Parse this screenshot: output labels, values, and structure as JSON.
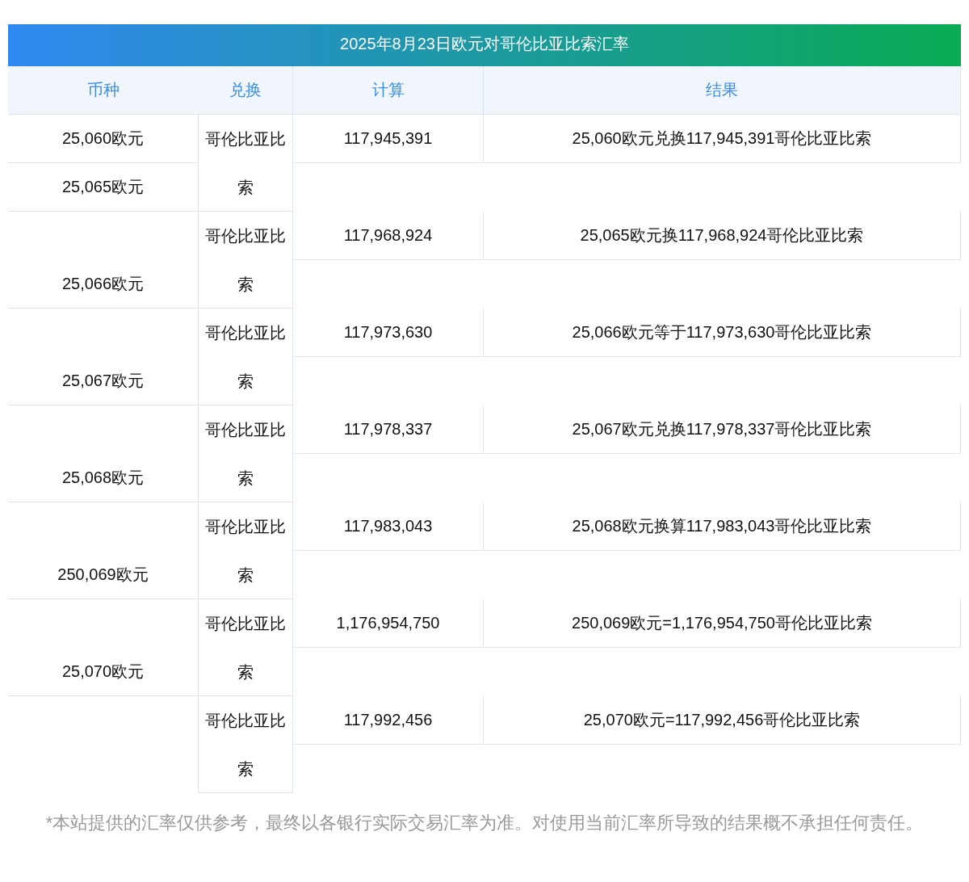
{
  "title": "2025年8月23日欧元对哥伦比亚比索汇率",
  "columns": [
    "币种",
    "兑换",
    "计算",
    "结果"
  ],
  "rows": [
    {
      "amount": "25,060欧元",
      "currency": "哥伦比亚比索",
      "calc": "117,945,391",
      "result": "25,060欧元兑换117,945,391哥伦比亚比索"
    },
    {
      "amount": "25,065欧元",
      "currency": "哥伦比亚比索",
      "calc": "117,968,924",
      "result": "25,065欧元换117,968,924哥伦比亚比索"
    },
    {
      "amount": "25,066欧元",
      "currency": "哥伦比亚比索",
      "calc": "117,973,630",
      "result": "25,066欧元等于117,973,630哥伦比亚比索"
    },
    {
      "amount": "25,067欧元",
      "currency": "哥伦比亚比索",
      "calc": "117,978,337",
      "result": "25,067欧元兑换117,978,337哥伦比亚比索"
    },
    {
      "amount": "25,068欧元",
      "currency": "哥伦比亚比索",
      "calc": "117,983,043",
      "result": "25,068欧元换算117,983,043哥伦比亚比索"
    },
    {
      "amount": "250,069欧元",
      "currency": "哥伦比亚比索",
      "calc": "1,176,954,750",
      "result": "250,069欧元=1,176,954,750哥伦比亚比索"
    },
    {
      "amount": "25,070欧元",
      "currency": "哥伦比亚比索",
      "calc": "117,992,456",
      "result": "25,070欧元=117,992,456哥伦比亚比索"
    }
  ],
  "footnote": "*本站提供的汇率仅供参考，最终以各银行实际交易汇率为准。对使用当前汇率所导致的结果概不承担任何责任。"
}
